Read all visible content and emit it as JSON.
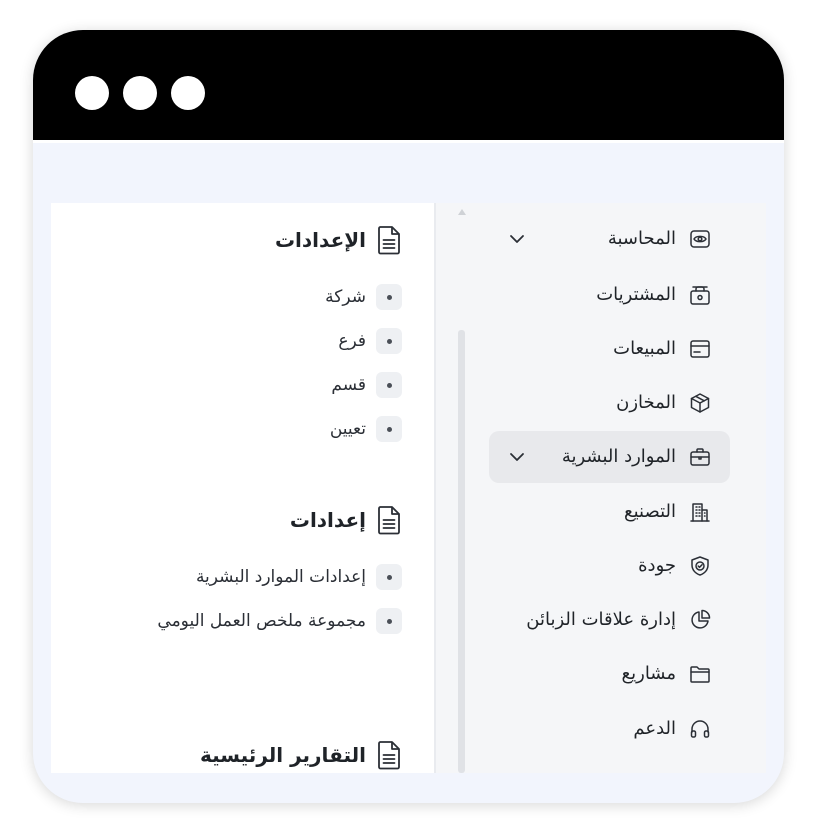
{
  "window": {
    "controls": [
      "close",
      "minimize",
      "maximize"
    ]
  },
  "sidebar": {
    "items": [
      {
        "label": "المحاسبة",
        "icon": "eye-icon",
        "expandable": true,
        "active": false
      },
      {
        "label": "المشتريات",
        "icon": "bag-icon",
        "expandable": false,
        "active": false
      },
      {
        "label": "المبيعات",
        "icon": "card-icon",
        "expandable": false,
        "active": false
      },
      {
        "label": "المخازن",
        "icon": "box-icon",
        "expandable": false,
        "active": false
      },
      {
        "label": "الموارد البشرية",
        "icon": "briefcase-icon",
        "expandable": true,
        "active": true
      },
      {
        "label": "التصنيع",
        "icon": "building-icon",
        "expandable": false,
        "active": false
      },
      {
        "label": "جودة",
        "icon": "shield-check-icon",
        "expandable": false,
        "active": false
      },
      {
        "label": "إدارة علاقات الزبائن",
        "icon": "pie-chart-icon",
        "expandable": false,
        "active": false
      },
      {
        "label": "مشاريع",
        "icon": "folder-icon",
        "expandable": false,
        "active": false
      },
      {
        "label": "الدعم",
        "icon": "headphones-icon",
        "expandable": false,
        "active": false
      }
    ]
  },
  "main": {
    "sections": [
      {
        "title": "الإعدادات",
        "links": [
          "شركة",
          "فرع",
          "قسم",
          "تعيين"
        ]
      },
      {
        "title": "إعدادات",
        "links": [
          "إعدادات الموارد البشرية",
          "مجموعة ملخص العمل اليومي"
        ]
      },
      {
        "title": "التقارير الرئيسية",
        "links": []
      }
    ]
  },
  "colors": {
    "titlebar": "#000000",
    "background": "#f2f5fd",
    "sidebar_bg": "#f5f6f8",
    "active_item_bg": "#e8e9ec",
    "text": "#1f2328"
  }
}
